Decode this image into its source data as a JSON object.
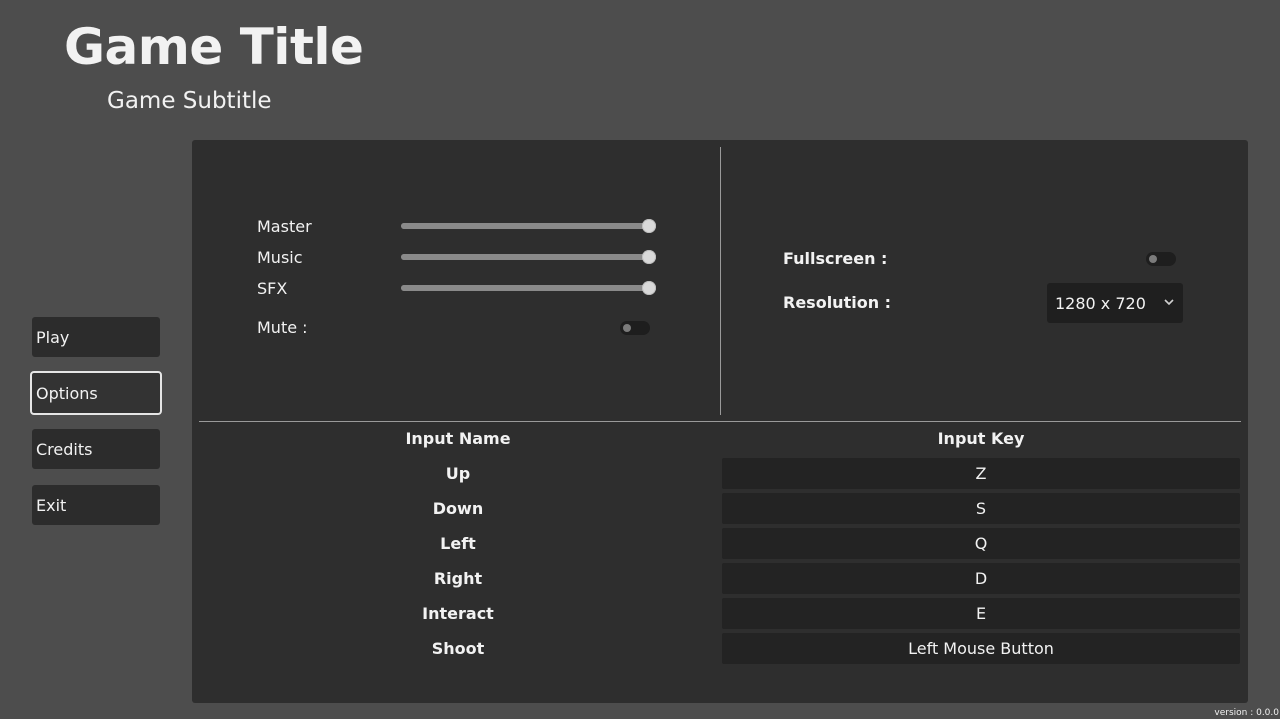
{
  "header": {
    "title": "Game Title",
    "subtitle": "Game Subtitle"
  },
  "menu": {
    "items": [
      {
        "label": "Play",
        "focused": false
      },
      {
        "label": "Options",
        "focused": true
      },
      {
        "label": "Credits",
        "focused": false
      },
      {
        "label": "Exit",
        "focused": false
      }
    ]
  },
  "audio": {
    "master": {
      "label": "Master",
      "value": 1.0
    },
    "music": {
      "label": "Music",
      "value": 1.0
    },
    "sfx": {
      "label": "SFX",
      "value": 1.0
    },
    "mute": {
      "label": "Mute :",
      "on": false
    }
  },
  "video": {
    "fullscreen": {
      "label": "Fullscreen :",
      "on": false
    },
    "resolution": {
      "label": "Resolution :",
      "value": "1280 x 720"
    }
  },
  "controls": {
    "name_header": "Input Name",
    "key_header": "Input Key",
    "rows": [
      {
        "name": "Up",
        "key": "Z"
      },
      {
        "name": "Down",
        "key": "S"
      },
      {
        "name": "Left",
        "key": "Q"
      },
      {
        "name": "Right",
        "key": "D"
      },
      {
        "name": "Interact",
        "key": "E"
      },
      {
        "name": "Shoot",
        "key": "Left Mouse Button"
      }
    ]
  },
  "footer": {
    "version": "version : 0.0.0"
  },
  "colors": {
    "background": "#4d4d4d",
    "panel": "#2e2e2e",
    "button": "#2c2c2c",
    "text": "#f2f2f2"
  }
}
